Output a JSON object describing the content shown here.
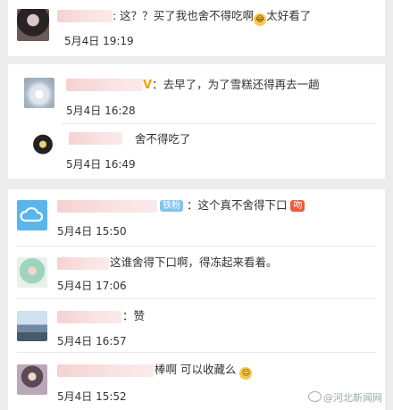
{
  "thread_a": {
    "comment": {
      "prefix": ": 这？？买了我也舍不得吃啊",
      "suffix": "太好看了",
      "emoji": "crying-laughing-emoji",
      "time": "5月4日 19:19"
    }
  },
  "thread_b": {
    "reply1": {
      "verified": "V",
      "text": "：去早了，为了雪糕还得再去一趟",
      "time": "5月4日 16:28"
    },
    "reply2": {
      "text": "舍不得吃了",
      "time": "5月4日 16:49"
    }
  },
  "thread_c": {
    "comment": {
      "badge": "铁粉",
      "text": "：这个真不舍得下口",
      "tag": "吻",
      "time": "5月4日 15:50"
    },
    "reply1": {
      "text": "这谁舍得下口啊，得冻起来看着。",
      "time": "5月4日 17:06"
    },
    "reply2": {
      "text": "：赞",
      "time": "5月4日 16:57"
    },
    "reply3": {
      "text": "棒啊 可以收藏么",
      "emoji": "shy-emoji",
      "time": "5月4日 15:52"
    }
  },
  "watermark": "@河北新闻网",
  "colors": {
    "badge_blue": "#7ec4ef",
    "tag_red": "#ef5b3a",
    "verified_gold": "#f3a200",
    "name_blur": "#f6d1d1"
  }
}
